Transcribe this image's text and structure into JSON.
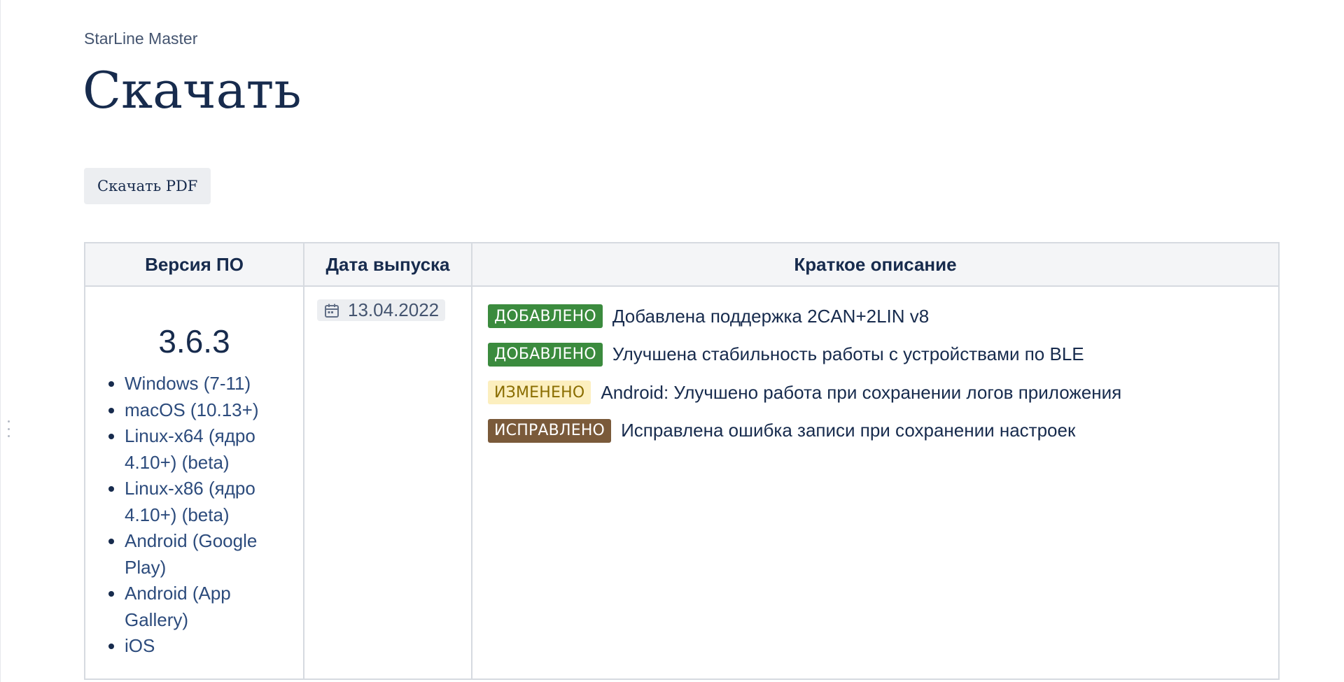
{
  "breadcrumb": "StarLine Master",
  "title": "Скачать",
  "pdf_button": "Скачать PDF",
  "table": {
    "headers": [
      "Версия ПО",
      "Дата выпуска",
      "Краткое описание"
    ],
    "rows": [
      {
        "version": "3.6.3",
        "platforms": [
          "Windows (7-11)",
          "macOS (10.13+)",
          "Linux-x64 (ядро 4.10+) (beta)",
          "Linux-x86 (ядро 4.10+) (beta)",
          "Android (Google Play)",
          "Android (App Gallery)",
          "iOS"
        ],
        "date": "13.04.2022",
        "changes": [
          {
            "badge": "ДОБАВЛЕНО",
            "type": "added",
            "text": "Добавлена поддержка 2CAN+2LIN v8"
          },
          {
            "badge": "ДОБАВЛЕНО",
            "type": "added",
            "text": "Улучшена стабильность работы с устройствами по BLE"
          },
          {
            "badge": "ИЗМЕНЕНО",
            "type": "changed",
            "text": "Android: Улучшено работа при сохранении логов приложения"
          },
          {
            "badge": "ИСПРАВЛЕНО",
            "type": "fixed",
            "text": "Исправлена ошибка записи при сохранении настроек"
          }
        ]
      }
    ]
  },
  "colors": {
    "added": "#3b8b3e",
    "changed": "#fcefbf",
    "fixed": "#7a5a3a",
    "link": "#2c4b7c",
    "text": "#172b4d"
  },
  "icons": {
    "date": "calendar-icon",
    "handle": "drag-handle-icon"
  }
}
